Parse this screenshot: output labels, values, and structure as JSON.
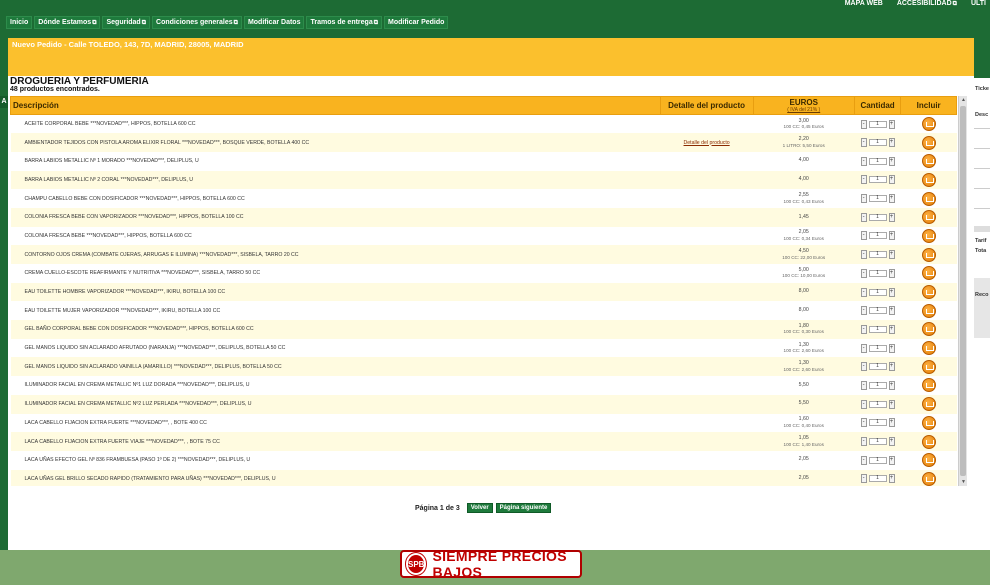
{
  "top_links": [
    {
      "label": "MAPA WEB",
      "external": false
    },
    {
      "label": "ACCESIBILIDAD",
      "external": true
    },
    {
      "label": "ULTI",
      "external": false
    }
  ],
  "nav": [
    {
      "label": "Inicio",
      "external": false
    },
    {
      "label": "Dónde Estamos",
      "external": true
    },
    {
      "label": "Seguridad",
      "external": true
    },
    {
      "label": "Condiciones generales",
      "external": true
    },
    {
      "label": "Modificar Datos",
      "external": false
    },
    {
      "label": "Tramos de entrega",
      "external": true
    },
    {
      "label": "Modificar Pedido",
      "external": false
    }
  ],
  "left_rail_label": "A",
  "order_line": "Nuevo Pedido - Calle TOLEDO, 143, 7D, MADRID, 28005, MADRID",
  "section": {
    "title": "DROGUERIA Y PERFUMERIA",
    "count": "48 productos encontrados."
  },
  "table": {
    "headers": {
      "desc": "Descripción",
      "detail": "Detalle del producto",
      "price": "EUROS",
      "price_sub": "( IVA del 21% )",
      "qty": "Cantidad",
      "incl": "Incluir"
    },
    "rows": [
      {
        "desc": "ACEITE CORPORAL BEBE ***NOVEDAD***, HIPPOS, BOTELLA 600 CC",
        "detail": "",
        "price": "3,00",
        "unit": "100 CC: 0,45 Euros",
        "qty": "1"
      },
      {
        "desc": "AMBIENTADOR TEJIDOS CON PISTOLA AROMA ELIXIR FLORAL ***NOVEDAD***, BOSQUE VERDE, BOTELLA 400 CC",
        "detail": "Detalle del producto",
        "price": "2,20",
        "unit": "1 LITRO: 5,50 Euros",
        "qty": "1"
      },
      {
        "desc": "BARRA LABIOS METALLIC Nº 1 MORADO ***NOVEDAD***, DELIPLUS, U",
        "detail": "",
        "price": "4,00",
        "unit": "",
        "qty": "1"
      },
      {
        "desc": "BARRA LABIOS METALLIC Nº 2 CORAL ***NOVEDAD***, DELIPLUS, U",
        "detail": "",
        "price": "4,00",
        "unit": "",
        "qty": "1"
      },
      {
        "desc": "CHAMPU CABELLO BEBE CON DOSIFICADOR ***NOVEDAD***, HIPPOS, BOTELLA 600 CC",
        "detail": "",
        "price": "2,55",
        "unit": "100 CC: 0,43 Euros",
        "qty": "1"
      },
      {
        "desc": "COLONIA FRESCA BEBE CON VAPORIZADOR ***NOVEDAD***, HIPPOS, BOTELLA 100 CC",
        "detail": "",
        "price": "1,45",
        "unit": "",
        "qty": "1"
      },
      {
        "desc": "COLONIA FRESCA BEBE ***NOVEDAD***, HIPPOS, BOTELLA 600 CC",
        "detail": "",
        "price": "2,05",
        "unit": "100 CC: 0,34 Euros",
        "qty": "1"
      },
      {
        "desc": "CONTORNO OJOS CREMA (COMBATE OJERAS, ARRUGAS E ILUMINA) ***NOVEDAD***, SISBELA, TARRO 20 CC",
        "detail": "",
        "price": "4,50",
        "unit": "100 CC: 22,00 Euros",
        "qty": "1"
      },
      {
        "desc": "CREMA CUELLO-ESCOTE REAFIRMANTE Y NUTRITIVA ***NOVEDAD***, SISBELA, TARRO 50 CC",
        "detail": "",
        "price": "5,00",
        "unit": "100 CC: 10,00 Euros",
        "qty": "1"
      },
      {
        "desc": "EAU TOILETTE HOMBRE VAPORIZADOR ***NOVEDAD***, IKIRU, BOTELLA 100 CC",
        "detail": "",
        "price": "8,00",
        "unit": "",
        "qty": "1"
      },
      {
        "desc": "EAU TOILETTE MUJER VAPORIZADOR ***NOVEDAD***, IKIRU, BOTELLA 100 CC",
        "detail": "",
        "price": "8,00",
        "unit": "",
        "qty": "1"
      },
      {
        "desc": "GEL BAÑO CORPORAL BEBE CON DOSIFICADOR ***NOVEDAD***, HIPPOS, BOTELLA 600 CC",
        "detail": "",
        "price": "1,80",
        "unit": "100 CC: 0,30 Euros",
        "qty": "1"
      },
      {
        "desc": "GEL MANOS LIQUIDO SIN ACLARADO AFRUTADO (NARANJA) ***NOVEDAD***, DELIPLUS, BOTELLA 50 CC",
        "detail": "",
        "price": "1,30",
        "unit": "100 CC: 2,60 Euros",
        "qty": "1"
      },
      {
        "desc": "GEL MANOS LIQUIDO SIN ACLARADO VAINILLA (AMARILLO) ***NOVEDAD***, DELIPLUS, BOTELLA 50 CC",
        "detail": "",
        "price": "1,30",
        "unit": "100 CC: 2,60 Euros",
        "qty": "1"
      },
      {
        "desc": "ILUMINADOR FACIAL EN CREMA METALLIC Nº1 LUZ DORADA ***NOVEDAD***, DELIPLUS, U",
        "detail": "",
        "price": "5,50",
        "unit": "",
        "qty": "1"
      },
      {
        "desc": "ILUMINADOR FACIAL EN CREMA METALLIC Nº2 LUZ PERLADA ***NOVEDAD***, DELIPLUS, U",
        "detail": "",
        "price": "5,50",
        "unit": "",
        "qty": "1"
      },
      {
        "desc": "LACA CABELLO FIJACION EXTRA FUERTE ***NOVEDAD***, , BOTE 400 CC",
        "detail": "",
        "price": "1,60",
        "unit": "100 CC: 0,40 Euros",
        "qty": "1"
      },
      {
        "desc": "LACA CABELLO FIJACION EXTRA FUERTE VIAJE ***NOVEDAD***, , BOTE 75 CC",
        "detail": "",
        "price": "1,05",
        "unit": "100 CC: 1,40 Euros",
        "qty": "1"
      },
      {
        "desc": "LACA UÑAS EFECTO GEL Nº 836 FRAMBUESA (PASO 1º DE 2) ***NOVEDAD***, DELIPLUS, U",
        "detail": "",
        "price": "2,05",
        "unit": "",
        "qty": "1"
      },
      {
        "desc": "LACA UÑAS GEL BRILLO SECADO RAPIDO (TRATAMIENTO PARA UÑAS) ***NOVEDAD***, DELIPLUS, U",
        "detail": "",
        "price": "2,05",
        "unit": "",
        "qty": "1"
      }
    ]
  },
  "pager": {
    "text": "Página 1 de 3",
    "back": "Volver",
    "next": "Página siguiente"
  },
  "banner": {
    "logo": "SPB",
    "text": "SIEMPRE PRECIOS BAJOS"
  },
  "right_panel": {
    "labels": [
      "Ticke",
      "Desc",
      "Tarif",
      "Tota",
      "Reco"
    ]
  },
  "colors": {
    "brand_green": "#1d6b34",
    "header_yellow": "#f9b31f",
    "accent_red": "#c00000"
  }
}
